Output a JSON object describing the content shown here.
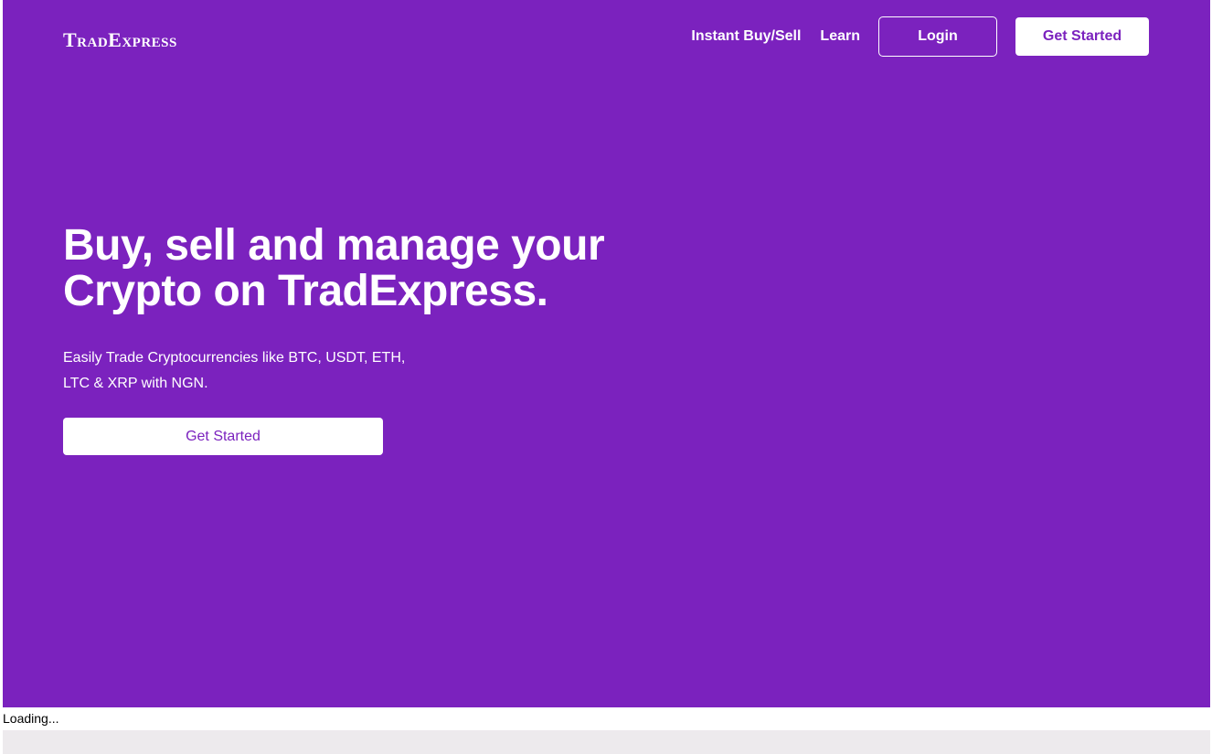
{
  "brand": {
    "logo_text": "TradExpress"
  },
  "nav": {
    "instant_label": "Instant Buy/Sell",
    "learn_label": "Learn",
    "login_label": "Login",
    "get_started_label": "Get Started"
  },
  "hero": {
    "headline": "Buy, sell and manage your Crypto on TradExpress.",
    "subtext": "Easily Trade Cryptocurrencies like BTC, USDT, ETH, LTC & XRP with NGN.",
    "cta_label": "Get Started"
  },
  "status": {
    "loading_text": "Loading..."
  },
  "colors": {
    "brand_purple": "#7b22be",
    "white": "#ffffff",
    "footer_bar": "#edeaed"
  }
}
